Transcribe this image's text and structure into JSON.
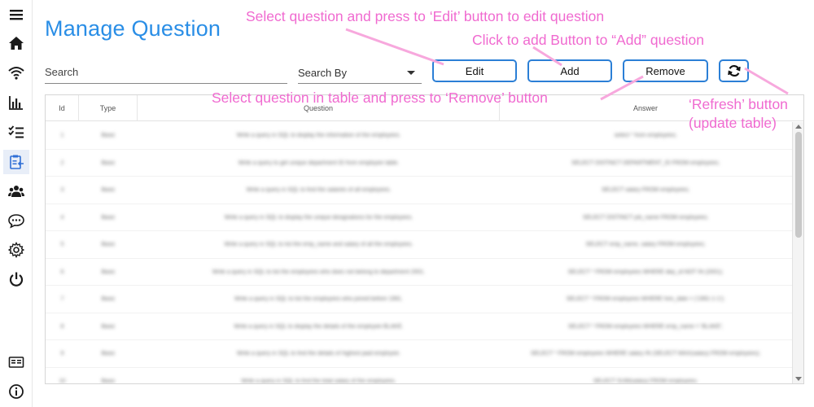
{
  "page": {
    "title": "Manage Question"
  },
  "sidebar": {
    "items": [
      {
        "icon": "menu-icon"
      },
      {
        "icon": "home-icon"
      },
      {
        "icon": "wifi-icon"
      },
      {
        "icon": "bar-chart-icon"
      },
      {
        "icon": "checklist-icon"
      },
      {
        "icon": "clipboard-icon",
        "active": true
      },
      {
        "icon": "users-icon"
      },
      {
        "icon": "chat-icon"
      },
      {
        "icon": "settings-icon"
      },
      {
        "icon": "power-icon"
      },
      {
        "icon": "id-card-icon"
      },
      {
        "icon": "info-icon"
      }
    ]
  },
  "toolbar": {
    "search_placeholder": "Search",
    "search_by_label": "Search By",
    "edit_label": "Edit",
    "add_label": "Add",
    "remove_label": "Remove",
    "refresh_icon": "refresh-icon"
  },
  "table": {
    "columns": [
      "Id",
      "Type",
      "Question",
      "Answer"
    ],
    "rows": [
      {
        "id": "1",
        "type": "Basic",
        "question": "Write a query in SQL to display the information of the employees.",
        "answer": "select * from employees;"
      },
      {
        "id": "2",
        "type": "Basic",
        "question": "Write a query to get unique department ID from employee table.",
        "answer": "SELECT DISTINCT DEPARTMENT_ID FROM employees;"
      },
      {
        "id": "3",
        "type": "Basic",
        "question": "Write a query in SQL to find the salaries of all employees.",
        "answer": "SELECT salary FROM employees;"
      },
      {
        "id": "4",
        "type": "Basic",
        "question": "Write a query in SQL to display the unique designations for the employees.",
        "answer": "SELECT DISTINCT job_name FROM employees;"
      },
      {
        "id": "5",
        "type": "Basic",
        "question": "Write a query in SQL to list the emp_name and salary of all the employees.",
        "answer": "SELECT emp_name, salary FROM employees;"
      },
      {
        "id": "6",
        "type": "Basic",
        "question": "Write a query in SQL to list the employees who does not belong to department 2001.",
        "answer": "SELECT * FROM employees WHERE dep_id NOT IN (2001);"
      },
      {
        "id": "7",
        "type": "Basic",
        "question": "Write a query in SQL to list the employees who joined before 1991.",
        "answer": "SELECT * FROM employees WHERE hire_date < ('1991-1-1');"
      },
      {
        "id": "8",
        "type": "Basic",
        "question": "Write a query in SQL to display the details of the employee BLAKE.",
        "answer": "SELECT * FROM employees WHERE emp_name = 'BLAKE';"
      },
      {
        "id": "9",
        "type": "Basic",
        "question": "Write a query in SQL to find the details of highest paid employee.",
        "answer": "SELECT * FROM employees WHERE salary IN (SELECT MAX(salary) FROM employees);"
      },
      {
        "id": "10",
        "type": "Basic",
        "question": "Write a query in SQL to find the total salary of the employees.",
        "answer": "SELECT SUM(salary) FROM employees;"
      }
    ]
  },
  "annotations": {
    "edit_note": "Select question and press to ‘Edit’ button to edit question",
    "add_note": "Click to add Button to “Add” question",
    "remove_note": "Select question in table and press to ‘Remove’  button",
    "refresh_note_line1": "‘Refresh’ button",
    "refresh_note_line2": "(update table)",
    "color": "#f06ad0"
  },
  "colors": {
    "accent": "#2b7fd6",
    "title": "#2a8ee6"
  }
}
